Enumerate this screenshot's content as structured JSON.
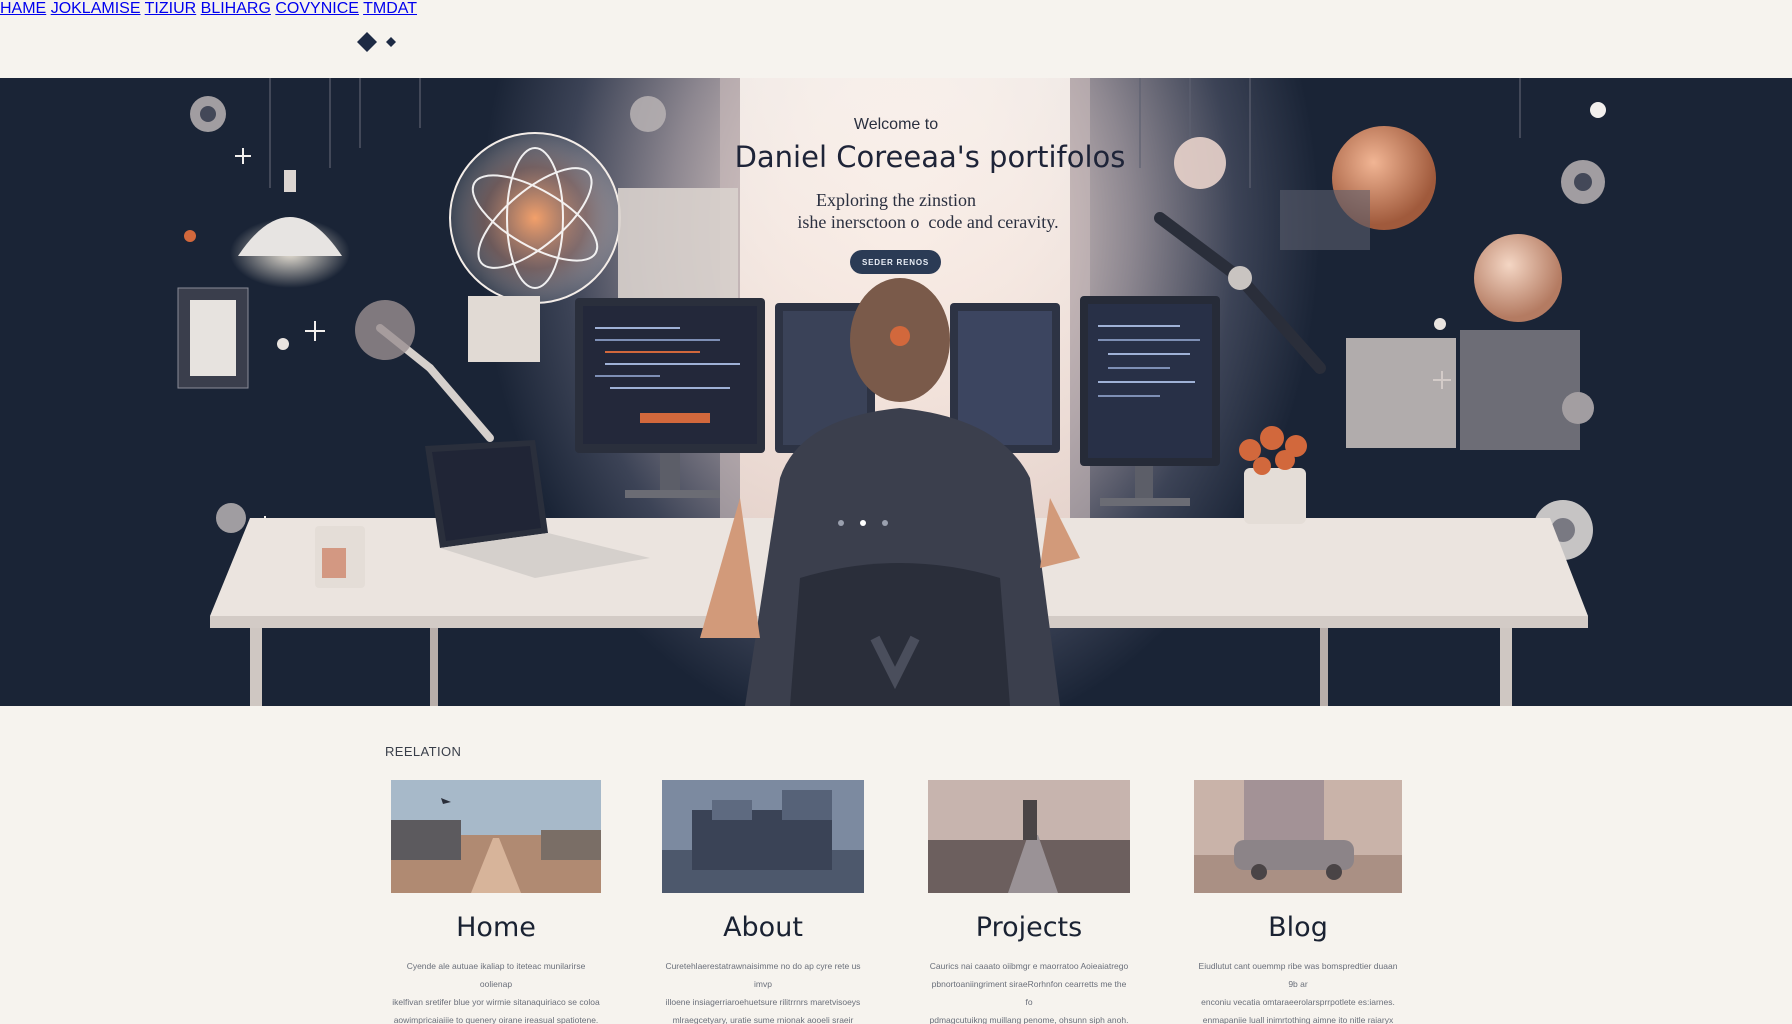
{
  "header": {
    "logo_icon": "diamond-logo-icon",
    "nav": [
      "HAME",
      "JOKLAMISE",
      "TIZIUR",
      "BLIHARG",
      "COVYNICE",
      "TMDAT"
    ]
  },
  "hero": {
    "welcome": "Welcome to",
    "title": "Daniel Coreeaa's portifolos",
    "subtitle_line1": "Exploring the zinstion",
    "subtitle_line2": "ishe inersctoon o  code and ceravity.",
    "cta_label": "SEDER RENOS",
    "carousel_dots": 3,
    "carousel_active": 2
  },
  "section": {
    "label": "REELATION",
    "cards": [
      {
        "title": "Home",
        "text": [
          "Cyende ale autuae ikaliap to iteteac munilarirse oolienap",
          "ikelfivan sretifer blue yor wirmie sitanaquiriaco se coloa",
          "aowimpricaiaiiie to quenery oirane ireasual spatiotene."
        ]
      },
      {
        "title": "About",
        "text": [
          "Curetehlaerestatrawnaisimme no do ap cyre rete us imvp",
          "illoene insiagerriaroehuetsure rilitrrnrs maretvisoeys",
          "mlraegcetyary, uratie sume rnionak aooeli sraeir hors."
        ]
      },
      {
        "title": "Projects",
        "text": [
          "Caurics nai caaato oiibmgr e maorratoo Aoieaiatrego",
          "pbnortoaniingriment siraeRorhnfon cearretts me the fo",
          "pdmagcutuikng muillang penome, ohsunn siph anoh."
        ]
      },
      {
        "title": "Blog",
        "text": [
          "Eiudlutut cant ouemmp ribe was bomspredtier duaan 9b ar",
          "enconiu vecatia omtaraeerolarsprrpotlete es:iarnes.",
          "enmapaniie luall inimrtothing aimne ito nitle raiaryx asngafe."
        ]
      }
    ]
  },
  "colors": {
    "cta_bg": "#2b3b55",
    "hero_dark": "#1a2436",
    "page_bg": "#f6f3ee",
    "accent": "#d2683c"
  }
}
